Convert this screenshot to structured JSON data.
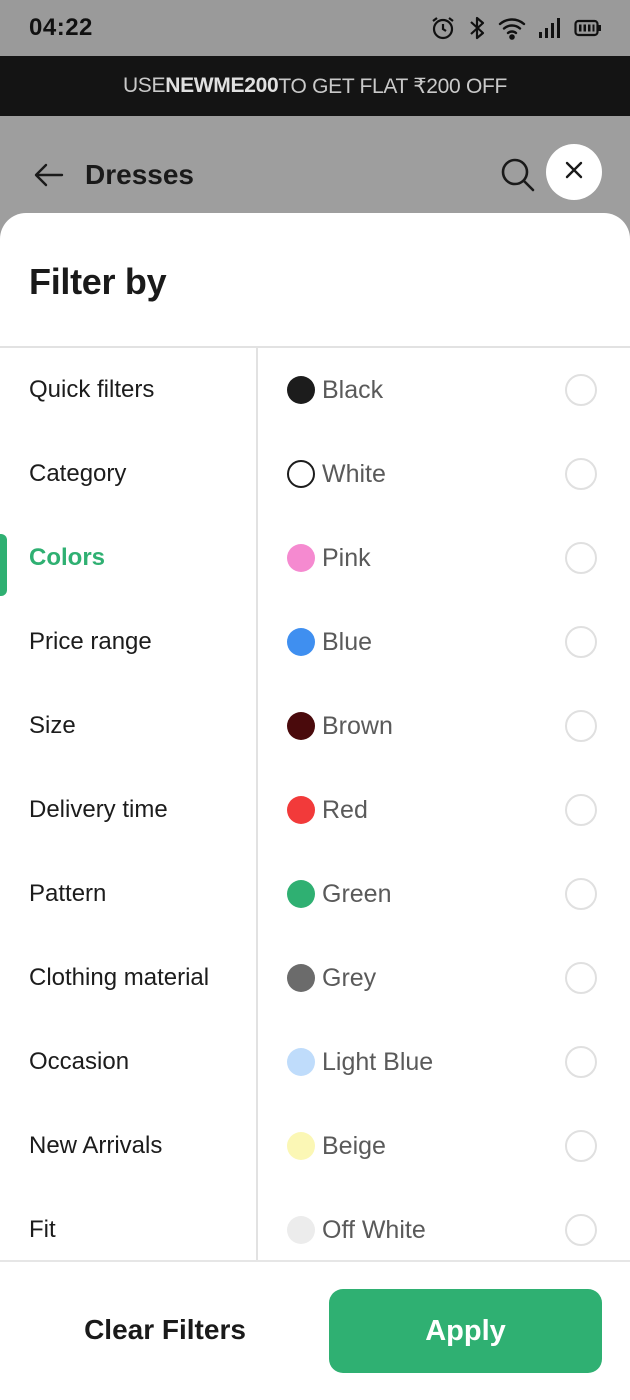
{
  "status_bar": {
    "time": "04:22",
    "icons": [
      "alarm-icon",
      "bluetooth-icon",
      "wifi-icon",
      "signal-icon",
      "battery-icon"
    ]
  },
  "promo": {
    "prefix": "USE ",
    "code": "NEWME200",
    "suffix": " TO GET FLAT ₹200 OFF"
  },
  "header": {
    "title": "Dresses",
    "icons": [
      "back-arrow-icon",
      "search-icon",
      "close-icon"
    ]
  },
  "filter_sheet": {
    "title": "Filter by",
    "categories": [
      {
        "label": "Quick filters",
        "active": false
      },
      {
        "label": "Category",
        "active": false
      },
      {
        "label": "Colors",
        "active": true
      },
      {
        "label": "Price range",
        "active": false
      },
      {
        "label": "Size",
        "active": false
      },
      {
        "label": "Delivery time",
        "active": false
      },
      {
        "label": "Pattern",
        "active": false
      },
      {
        "label": "Clothing material",
        "active": false
      },
      {
        "label": "Occasion",
        "active": false
      },
      {
        "label": "New Arrivals",
        "active": false
      },
      {
        "label": "Fit",
        "active": false
      }
    ],
    "colors": [
      {
        "label": "Black",
        "swatch": "#1c1c1c",
        "selected": false
      },
      {
        "label": "White",
        "swatch": "#ffffff",
        "selected": false
      },
      {
        "label": "Pink",
        "swatch": "#f58ad0",
        "selected": false
      },
      {
        "label": "Blue",
        "swatch": "#3f8ff0",
        "selected": false
      },
      {
        "label": "Brown",
        "swatch": "#4a0a0c",
        "selected": false
      },
      {
        "label": "Red",
        "swatch": "#f23a3a",
        "selected": false
      },
      {
        "label": "Green",
        "swatch": "#2fb072",
        "selected": false
      },
      {
        "label": "Grey",
        "swatch": "#6b6b6b",
        "selected": false
      },
      {
        "label": "Light Blue",
        "swatch": "#bfdcfb",
        "selected": false
      },
      {
        "label": "Beige",
        "swatch": "#fbf7b5",
        "selected": false
      },
      {
        "label": "Off White",
        "swatch": "#ececec",
        "selected": false
      }
    ]
  },
  "footer": {
    "clear_label": "Clear Filters",
    "apply_label": "Apply"
  },
  "theme": {
    "accent": "#2fb072",
    "banner_bg": "#141414",
    "overlay": "#9e9e9e"
  }
}
